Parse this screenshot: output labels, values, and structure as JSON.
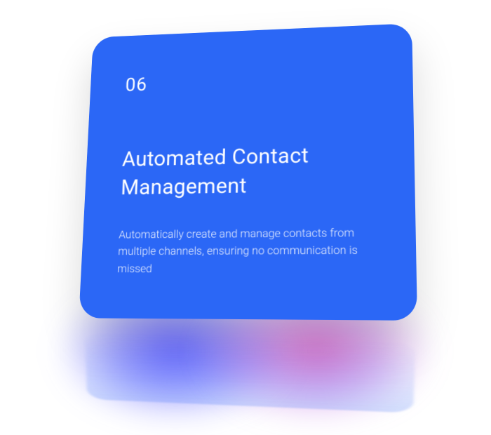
{
  "card": {
    "number": "06",
    "title": "Automated Contact Management",
    "description": "Automatically create and manage contacts from multiple channels, ensuring no communication is missed"
  },
  "colors": {
    "cardBackground": "#2b67f6",
    "glowBlue": "#4446ff",
    "glowPurple": "#c832b4"
  }
}
